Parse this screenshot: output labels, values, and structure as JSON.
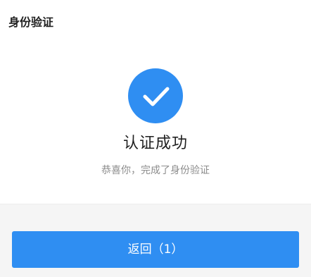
{
  "header": {
    "title": "身份验证"
  },
  "result": {
    "icon": "check-circle-icon",
    "title": "认证成功",
    "subtitle": "恭喜你，完成了身份验证"
  },
  "actions": {
    "back_label": "返回（1）"
  },
  "colors": {
    "accent": "#2f8ef2",
    "background": "#f5f5f5",
    "card": "#ffffff"
  }
}
